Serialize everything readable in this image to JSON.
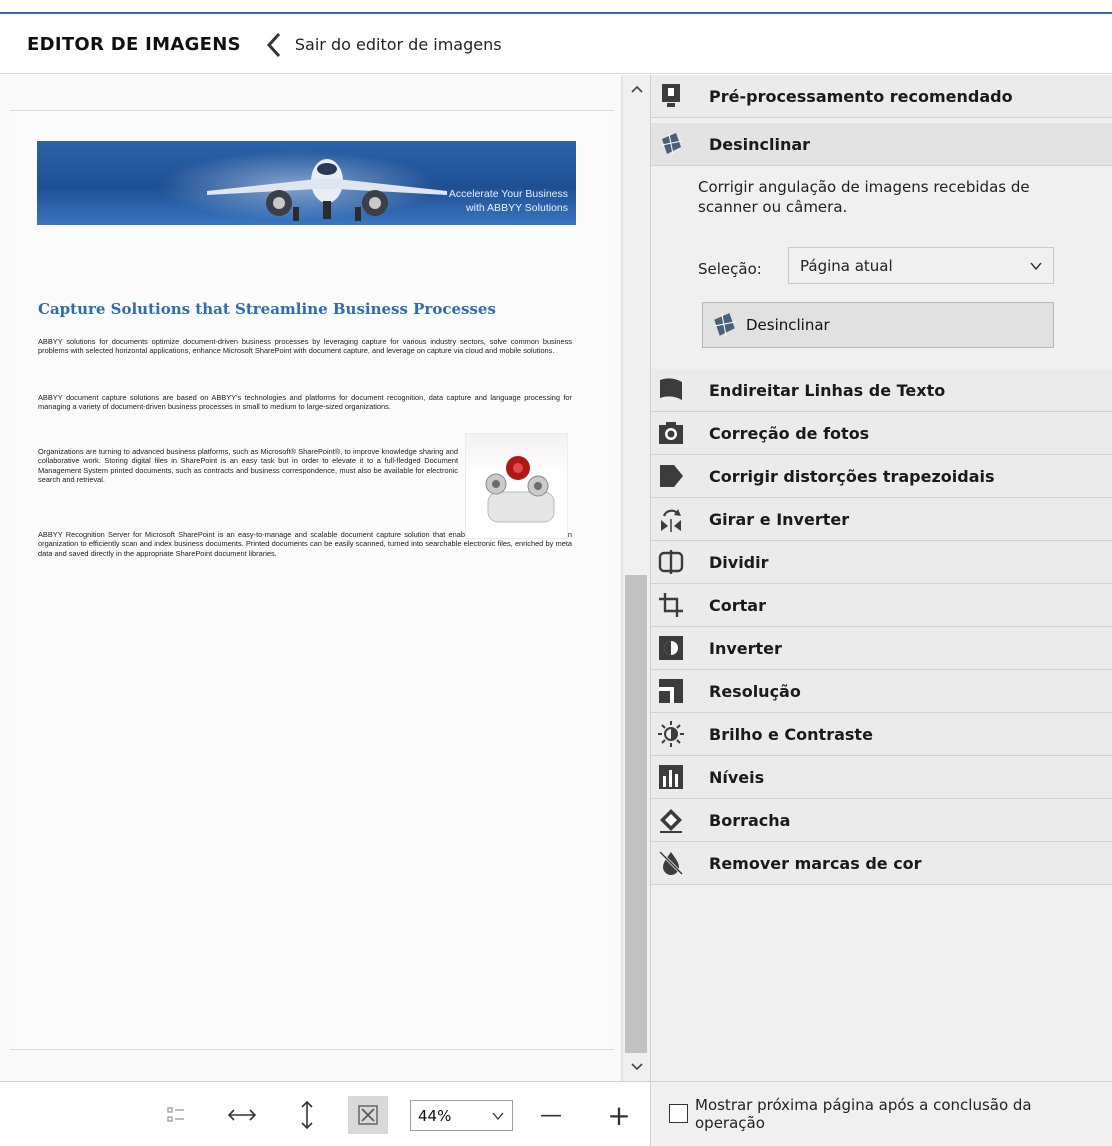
{
  "header": {
    "title": "EDITOR DE IMAGENS",
    "back_label": "Sair do editor de imagens"
  },
  "document": {
    "banner_line1": "Accelerate Your Business",
    "banner_line2": "with ABBYY Solutions",
    "heading": "Capture Solutions that Streamline Business Processes",
    "paragraphs": [
      "ABBYY solutions for documents optimize document-driven business processes by leveraging capture for various industry sectors, solve common business problems with selected horizontal applications, enhance Microsoft SharePoint with document capture, and leverage on capture via cloud and mobile solutions.",
      "ABBYY document capture solutions are based on ABBYY's technologies and platforms for document recognition, data capture and language processing for managing a variety of document-driven business processes in small to medium to large-sized organizations.",
      "Organizations are turning to advanced business platforms, such as Microsoft® SharePoint®, to improve knowledge sharing and collaborative work. Storing digital files in SharePoint is an easy task but in order to elevate it to a full-fledged Document Management System printed documents, such as contracts and business correspondence, must also be available for electronic search and retrieval.",
      "ABBYY Recognition Server for Microsoft SharePoint is an easy-to-manage and scalable document capture solution that enables SharePoint users across an organization to efficiently scan and index business documents. Printed documents can be easily scanned, turned into searchable electronic files, enriched by meta data and saved directly in the appropriate SharePoint document libraries."
    ]
  },
  "tools": {
    "preprocess": "Pré-processamento recomendado",
    "deskew": "Desinclinar",
    "deskew_desc": "Corrigir angulação de imagens recebidas de scanner ou câmera.",
    "selection_label": "Seleção:",
    "selection_value": "Página atual",
    "deskew_button": "Desinclinar",
    "straighten": "Endireitar Linhas de Texto",
    "photo": "Correção de fotos",
    "trapezoid": "Corrigir distorções trapezoidais",
    "rotate": "Girar e Inverter",
    "split": "Dividir",
    "crop": "Cortar",
    "invert": "Inverter",
    "resolution": "Resolução",
    "brightness": "Brilho e Contraste",
    "levels": "Níveis",
    "eraser": "Borracha",
    "remove_color": "Remover marcas de cor"
  },
  "bottom": {
    "zoom_value": "44%",
    "minus": "—",
    "plus": "+",
    "show_next_label": "Mostrar próxima página após a conclusão da operação"
  },
  "colors": {
    "accent_blue": "#2f6cb0",
    "panel_bg": "#f0f0f0",
    "tool_row_bg": "#ebebeb"
  }
}
